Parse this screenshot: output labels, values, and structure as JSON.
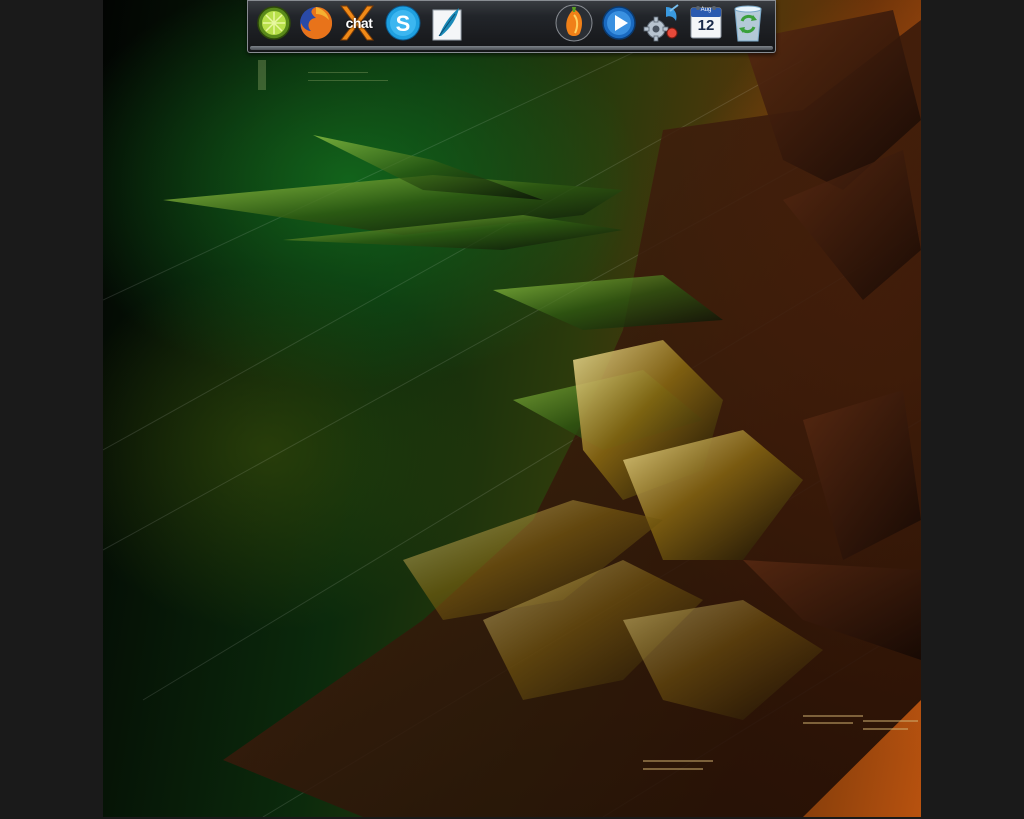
{
  "desktop": {
    "wallpaper": "abstract-dark-sculpture-wallpaper",
    "colors": {
      "screen_bg": "#1a1a1a",
      "green_glow": "#146e1e",
      "orange_glow": "#c85a14"
    }
  },
  "dock": {
    "items": [
      {
        "name": "limewire-icon",
        "label": ""
      },
      {
        "name": "firefox-icon",
        "label": ""
      },
      {
        "name": "xchat-icon",
        "label": "chat"
      },
      {
        "name": "skype-icon",
        "label": ""
      },
      {
        "name": "feather-document-icon",
        "label": ""
      },
      {
        "name": "fl-studio-icon",
        "label": ""
      },
      {
        "name": "media-player-icon",
        "label": ""
      },
      {
        "name": "settings-gears-icon",
        "label": ""
      },
      {
        "name": "calendar-icon",
        "label": "12",
        "month": "Aug"
      },
      {
        "name": "recycle-bin-icon",
        "label": ""
      }
    ]
  }
}
